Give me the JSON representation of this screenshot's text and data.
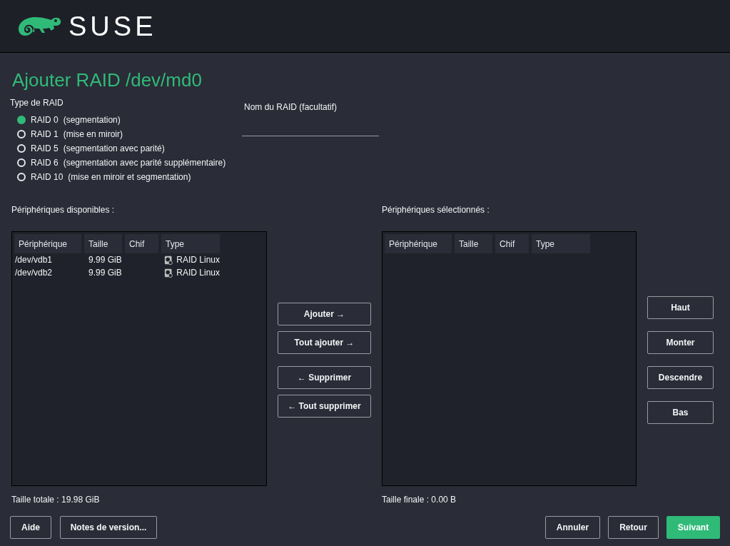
{
  "header": {
    "logo_text": "SUSE"
  },
  "title": "Ajouter RAID /dev/md0",
  "raid_type": {
    "label": "Type de RAID",
    "options": [
      {
        "level": "RAID 0",
        "desc": "(segmentation)",
        "selected": true
      },
      {
        "level": "RAID 1",
        "desc": "(mise en miroir)",
        "selected": false
      },
      {
        "level": "RAID 5",
        "desc": "(segmentation avec parité)",
        "selected": false
      },
      {
        "level": "RAID 6",
        "desc": "(segmentation avec parité supplémentaire)",
        "selected": false
      },
      {
        "level": "RAID 10",
        "desc": "(mise en miroir et segmentation)",
        "selected": false
      }
    ]
  },
  "raid_name": {
    "label": "Nom du RAID (facultatif)"
  },
  "available": {
    "label": "Périphériques disponibles :",
    "columns": [
      "Périphérique",
      "Taille",
      "Chif",
      "Type"
    ],
    "rows": [
      {
        "device": "/dev/vdb1",
        "size": "9.99 GiB",
        "type": "RAID Linux"
      },
      {
        "device": "/dev/vdb2",
        "size": "9.99 GiB",
        "type": "RAID Linux"
      }
    ],
    "total": "Taille totale : 19.98 GiB"
  },
  "move_buttons": [
    [
      "Ajouter →",
      "Tout ajouter →"
    ],
    [
      "← Supprimer",
      "← Tout supprimer"
    ]
  ],
  "selected": {
    "label": "Périphériques sélectionnés :",
    "columns": [
      "Périphérique",
      "Taille",
      "Chif",
      "Type"
    ],
    "total": "Taille finale : 0.00 B"
  },
  "order_buttons": [
    "Haut",
    "Monter",
    "Descendre",
    "Bas"
  ],
  "footer": {
    "left": [
      "Aide",
      "Notes de version..."
    ],
    "right": [
      {
        "label": "Annuler",
        "kind": "plain"
      },
      {
        "label": "Retour",
        "kind": "plain"
      },
      {
        "label": "Suivant",
        "kind": "primary"
      }
    ]
  }
}
